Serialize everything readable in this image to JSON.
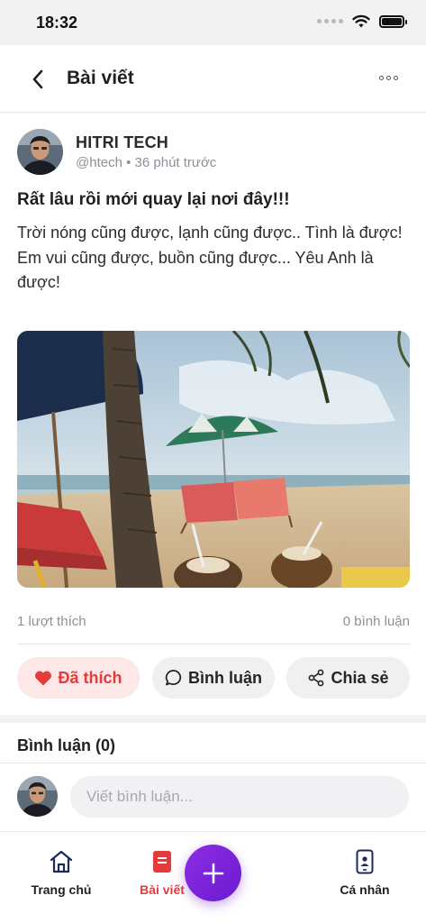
{
  "status_bar": {
    "time": "18:32"
  },
  "header": {
    "title": "Bài viết"
  },
  "post": {
    "author_name": "HITRI TECH",
    "author_handle": "@htech",
    "time_ago": "36 phút trước",
    "meta_separator": "•",
    "title": "Rất lâu rồi mới quay lại nơi đây!!!",
    "body_lines": [
      "Trời nóng cũng được, lạnh cũng được.. Tình là được!",
      "Em vui cũng được, buồn cũng được... Yêu Anh là được!"
    ],
    "likes": "1 lượt thích",
    "comments": "0 bình luận"
  },
  "actions": {
    "like_label": "Đã thích",
    "comment_label": "Bình luận",
    "share_label": "Chia sẻ"
  },
  "comments_section": {
    "title": "Bình luận (0)",
    "input_placeholder": "Viết bình luận..."
  },
  "bottom_nav": {
    "home": "Trang chủ",
    "posts": "Bài viết",
    "profile": "Cá nhân"
  },
  "colors": {
    "accent_red": "#e53b3b",
    "fab_purple": "#7b22d9",
    "like_bg": "#fde7e7"
  },
  "icons": {
    "back": "chevron-left-icon",
    "more": "more-horizontal-icon",
    "like": "heart-icon",
    "comment": "chat-bubble-icon",
    "share": "share-icon",
    "home": "home-icon",
    "posts": "document-icon",
    "add": "plus-icon",
    "profile": "phone-user-icon"
  }
}
